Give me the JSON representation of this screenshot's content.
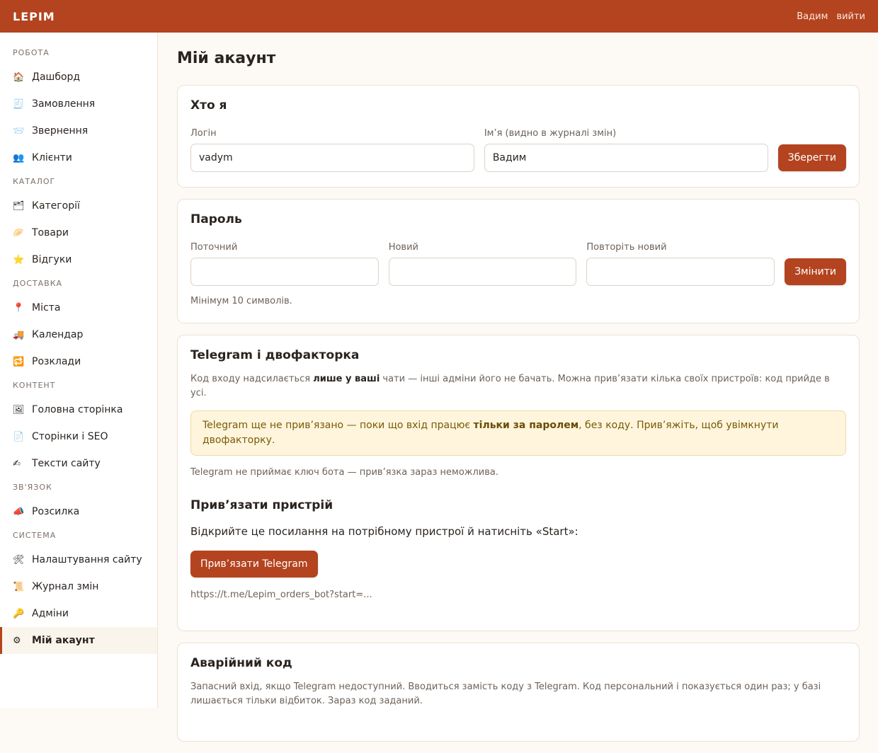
{
  "header": {
    "brand": "LEPIM",
    "user": "Вадим",
    "logout": "вийти"
  },
  "sidebar": {
    "sections": [
      {
        "title": "РОБОТА",
        "items": [
          {
            "icon": "🏠",
            "icon_name": "house-icon",
            "label": "Дашборд"
          },
          {
            "icon": "🧾",
            "icon_name": "receipt-icon",
            "label": "Замовлення"
          },
          {
            "icon": "📨",
            "icon_name": "envelope-icon",
            "label": "Звернення"
          },
          {
            "icon": "👥",
            "icon_name": "people-icon",
            "label": "Клієнти"
          }
        ]
      },
      {
        "title": "КАТАЛОГ",
        "items": [
          {
            "icon": "🗂",
            "icon_name": "folder-icon",
            "label": "Категорії"
          },
          {
            "icon": "🥟",
            "icon_name": "dumpling-icon",
            "label": "Товари"
          },
          {
            "icon": "⭐",
            "icon_name": "star-icon",
            "label": "Відгуки"
          }
        ]
      },
      {
        "title": "ДОСТАВКА",
        "items": [
          {
            "icon": "📍",
            "icon_name": "pin-icon",
            "label": "Міста"
          },
          {
            "icon": "🚚",
            "icon_name": "truck-icon",
            "label": "Календар"
          },
          {
            "icon": "🔁",
            "icon_name": "repeat-icon",
            "label": "Розклади"
          }
        ]
      },
      {
        "title": "КОНТЕНТ",
        "items": [
          {
            "icon": "🖼",
            "icon_name": "picture-icon",
            "label": "Головна сторінка"
          },
          {
            "icon": "📄",
            "icon_name": "page-icon",
            "label": "Сторінки і SEO"
          },
          {
            "icon": "✍",
            "icon_name": "writing-icon",
            "label": "Тексти сайту"
          }
        ]
      },
      {
        "title": "ЗВ'ЯЗОК",
        "items": [
          {
            "icon": "📣",
            "icon_name": "megaphone-icon",
            "label": "Розсилка"
          }
        ]
      },
      {
        "title": "СИСТЕМА",
        "items": [
          {
            "icon": "🛠",
            "icon_name": "tools-icon",
            "label": "Налаштування сайту"
          },
          {
            "icon": "📜",
            "icon_name": "scroll-icon",
            "label": "Журнал змін"
          },
          {
            "icon": "🔑",
            "icon_name": "key-icon",
            "label": "Адміни"
          },
          {
            "icon": "⚙",
            "icon_name": "gear-icon",
            "label": "Мій акаунт",
            "active": true
          }
        ]
      }
    ]
  },
  "main": {
    "title": "Мій акаунт",
    "who": {
      "heading": "Хто я",
      "login_label": "Логін",
      "login_value": "vadym",
      "name_label": "Ім’я (видно в журналі змін)",
      "name_value": "Вадим",
      "save": "Зберегти"
    },
    "password": {
      "heading": "Пароль",
      "current_label": "Поточний",
      "new_label": "Новий",
      "repeat_label": "Повторіть новий",
      "change": "Змінити",
      "hint": "Мінімум 10 символів."
    },
    "telegram": {
      "heading": "Telegram і двофакторка",
      "desc_pre": "Код входу надсилається ",
      "desc_bold": "лише у ваші",
      "desc_post": " чати — інші адміни його не бачать. Можна прив’язати кілька своїх пристроїв: код прийде в усі.",
      "warn_pre": "Telegram ще не прив’язано — поки що вхід працює ",
      "warn_bold": "тільки за паролем",
      "warn_post": ", без коду. Прив’яжіть, щоб увімкнути двофакторку.",
      "note": "Telegram не приймає ключ бота — прив’язка зараз неможлива.",
      "bind_heading": "Прив’язати пристрій",
      "instruction": "Відкрийте це посилання на потрібному пристрої й натисніть «Start»:",
      "bind_button": "Прив’язати Telegram",
      "link": "https://t.me/Lepim_orders_bot?start=..."
    },
    "emergency": {
      "heading": "Аварійний код",
      "desc": "Запасний вхід, якщо Telegram недоступний. Вводиться замість коду з Telegram. Код персональний і показується один раз; у базі лишається тільки відбиток. Зараз код заданий."
    }
  }
}
